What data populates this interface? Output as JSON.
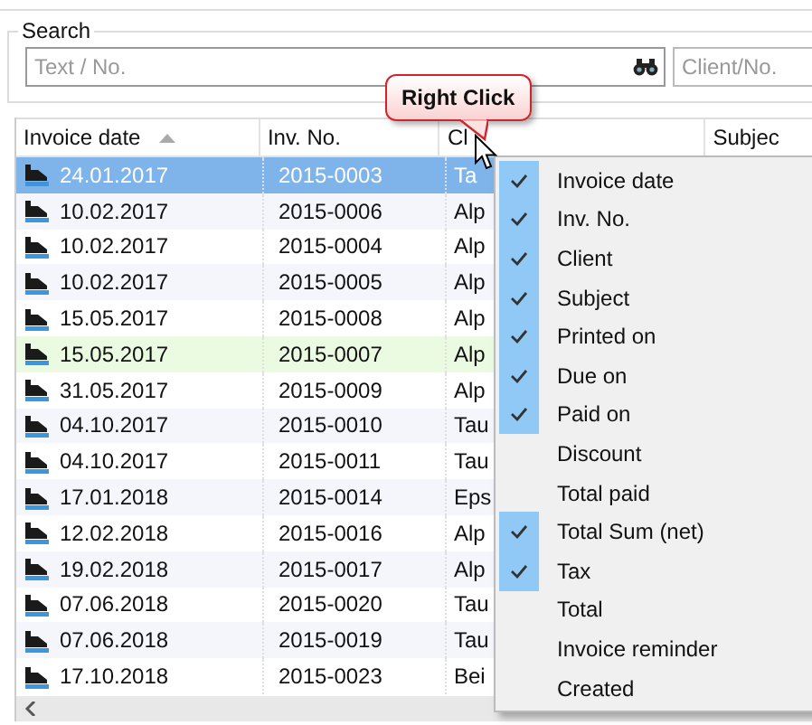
{
  "search": {
    "label": "Search",
    "placeholder": "Text / No.",
    "client_placeholder": "Client/No."
  },
  "callout": {
    "text": "Right Click"
  },
  "table": {
    "columns": [
      {
        "label": "Invoice date",
        "sorted": true
      },
      {
        "label": "Inv. No.",
        "sorted": false
      },
      {
        "label": "Cl",
        "sorted": false
      },
      {
        "label": "Subjec",
        "sorted": false
      }
    ],
    "rows": [
      {
        "cells": [
          "24.01.2017",
          "2015-0003",
          "Ta"
        ],
        "selected": true,
        "highlighted": false
      },
      {
        "cells": [
          "10.02.2017",
          "2015-0006",
          "Alp"
        ],
        "selected": false,
        "highlighted": false
      },
      {
        "cells": [
          "10.02.2017",
          "2015-0004",
          "Alp"
        ],
        "selected": false,
        "highlighted": false
      },
      {
        "cells": [
          "10.02.2017",
          "2015-0005",
          "Alp"
        ],
        "selected": false,
        "highlighted": false
      },
      {
        "cells": [
          "15.05.2017",
          "2015-0008",
          "Alp"
        ],
        "selected": false,
        "highlighted": false
      },
      {
        "cells": [
          "15.05.2017",
          "2015-0007",
          "Alp"
        ],
        "selected": false,
        "highlighted": true
      },
      {
        "cells": [
          "31.05.2017",
          "2015-0009",
          "Alp"
        ],
        "selected": false,
        "highlighted": false
      },
      {
        "cells": [
          "04.10.2017",
          "2015-0010",
          "Tau"
        ],
        "selected": false,
        "highlighted": false
      },
      {
        "cells": [
          "04.10.2017",
          "2015-0011",
          "Tau"
        ],
        "selected": false,
        "highlighted": false
      },
      {
        "cells": [
          "17.01.2018",
          "2015-0014",
          "Eps"
        ],
        "selected": false,
        "highlighted": false
      },
      {
        "cells": [
          "12.02.2018",
          "2015-0016",
          "Alp"
        ],
        "selected": false,
        "highlighted": false
      },
      {
        "cells": [
          "19.02.2018",
          "2015-0017",
          "Alp"
        ],
        "selected": false,
        "highlighted": false
      },
      {
        "cells": [
          "07.06.2018",
          "2015-0020",
          "Tau"
        ],
        "selected": false,
        "highlighted": false
      },
      {
        "cells": [
          "07.06.2018",
          "2015-0019",
          "Tau"
        ],
        "selected": false,
        "highlighted": false
      },
      {
        "cells": [
          "17.10.2018",
          "2015-0023",
          "Bei"
        ],
        "selected": false,
        "highlighted": false
      }
    ]
  },
  "context_menu": {
    "items": [
      {
        "label": "Invoice date",
        "checked": true
      },
      {
        "label": "Inv. No.",
        "checked": true
      },
      {
        "label": "Client",
        "checked": true
      },
      {
        "label": "Subject",
        "checked": true
      },
      {
        "label": "Printed on",
        "checked": true
      },
      {
        "label": "Due on",
        "checked": true
      },
      {
        "label": "Paid on",
        "checked": true
      },
      {
        "label": "Discount",
        "checked": false
      },
      {
        "label": "Total paid",
        "checked": false
      },
      {
        "label": "Total Sum (net)",
        "checked": true
      },
      {
        "label": "Tax",
        "checked": true
      },
      {
        "label": "Total",
        "checked": false
      },
      {
        "label": "Invoice reminder",
        "checked": false
      },
      {
        "label": "Created",
        "checked": false
      }
    ]
  }
}
